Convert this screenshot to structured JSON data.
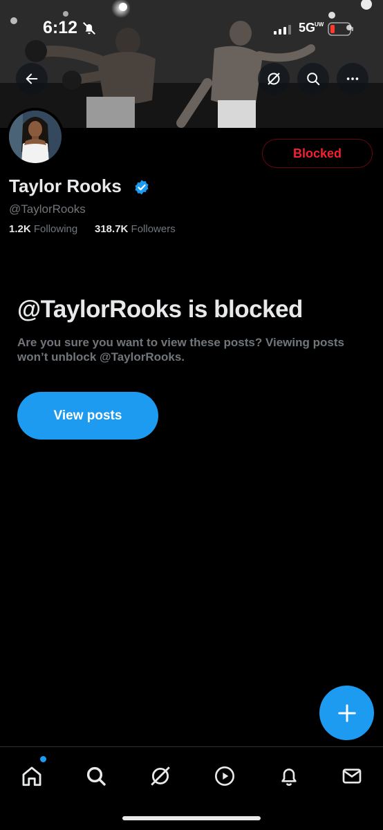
{
  "status_bar": {
    "time": "6:12",
    "network": "5G",
    "network_sup": "UW"
  },
  "profile": {
    "name": "Taylor Rooks",
    "handle": "@TaylorRooks",
    "following_count": "1.2K",
    "following_label": "Following",
    "followers_count": "318.7K",
    "followers_label": "Followers",
    "relationship_button": "Blocked"
  },
  "blocked_notice": {
    "title": "@TaylorRooks is blocked",
    "message": "Are you sure you want to view these posts? Viewing posts won’t unblock @TaylorRooks.",
    "action_label": "View posts"
  },
  "header_icons": [
    "back-arrow-icon",
    "grok-icon",
    "search-icon",
    "more-icon"
  ],
  "tab_bar": [
    "home-icon",
    "search-icon",
    "grok-icon",
    "video-icon",
    "notifications-icon",
    "messages-icon"
  ],
  "colors": {
    "accent": "#1d9bf0",
    "blocked_red": "#f4212e",
    "secondary_text": "#71767b",
    "background": "#000000"
  }
}
